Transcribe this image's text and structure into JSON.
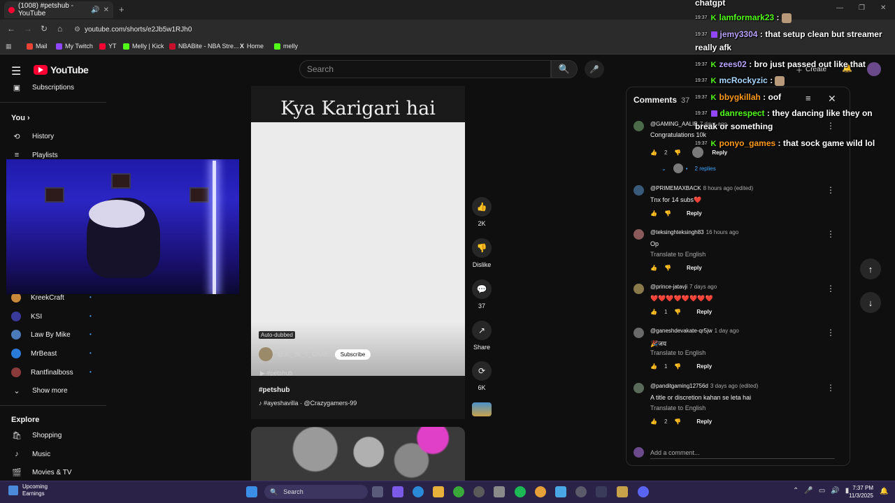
{
  "browser": {
    "tab_title": "(1008) #petshub - YouTube",
    "new_tab": "+",
    "url": "youtube.com/shorts/e2Jb5w1RJh0",
    "bookmarks": [
      {
        "label": "Mail",
        "color": "#e8e8e8"
      },
      {
        "label": "My Twitch",
        "color": "#9146ff"
      },
      {
        "label": "YT",
        "color": "#ff0033"
      },
      {
        "label": "Melly | Kick",
        "color": "#53fc18"
      },
      {
        "label": "NBABite - NBA Stre...",
        "color": "#c8102e"
      },
      {
        "label": "Home",
        "color": "#e8e8e8"
      },
      {
        "label": "melly",
        "color": "#53fc18"
      }
    ]
  },
  "youtube": {
    "logo_text": "YouTube",
    "search_placeholder": "Search",
    "create_label": "Create"
  },
  "sidebar": {
    "subscriptions": "Subscriptions",
    "you": "You",
    "you_chevron": "›",
    "history": "History",
    "playlists": "Playlists",
    "channels": [
      {
        "name": "KreekCraft",
        "color": "#c88a3a"
      },
      {
        "name": "KSI",
        "color": "#3a3a9a"
      },
      {
        "name": "Law By Mike",
        "color": "#4a7ab8"
      },
      {
        "name": "MrBeast",
        "color": "#2a7ad8"
      },
      {
        "name": "Rantfinalboss",
        "color": "#8a3a3a"
      }
    ],
    "show_more": "Show more",
    "explore": "Explore",
    "explore_items": [
      "Shopping",
      "Music",
      "Movies & TV"
    ]
  },
  "short": {
    "title_overlay": "Kya Karigari hai",
    "auto_dubbed": "Auto-dubbed",
    "channel": "@30_36_Y_GAME",
    "subscribe": "Subscribe",
    "tagline": "#petshub",
    "hashtag": "#petshub",
    "music": "#ayeshavilla · @Crazygamers-99",
    "actions": [
      {
        "icon": "like",
        "glyph": "👍",
        "label": "2K"
      },
      {
        "icon": "dislike",
        "glyph": "👎",
        "label": "Dislike"
      },
      {
        "icon": "comment",
        "glyph": "💬",
        "label": "37"
      },
      {
        "icon": "share",
        "glyph": "↗",
        "label": "Share"
      },
      {
        "icon": "remix",
        "glyph": "⟳",
        "label": "6K"
      }
    ]
  },
  "comments": {
    "title": "Comments",
    "count": "37",
    "add_placeholder": "Add a comment...",
    "items": [
      {
        "author": "@GAMING_AALIB",
        "time": "7 days ago",
        "text": "Congratulations 10k",
        "translate": "",
        "likes": "2",
        "reply": "Reply",
        "replies": "2 replies",
        "av": "#4a6a4a"
      },
      {
        "author": "@PRIMEMAXBACK",
        "time": "8 hours ago (edited)",
        "text": "Tnx for 14 subs❤️",
        "translate": "",
        "likes": "",
        "reply": "Reply",
        "replies": "",
        "av": "#3a5a7a"
      },
      {
        "author": "@teksinghteksingh83",
        "time": "16 hours ago",
        "text": "Op",
        "translate": "Translate to English",
        "likes": "",
        "reply": "Reply",
        "replies": "",
        "av": "#8a5a5a"
      },
      {
        "author": "@prince-jatavji",
        "time": "7 days ago",
        "text": "❤️❤️❤️❤️❤️❤️❤️❤️",
        "translate": "",
        "likes": "1",
        "reply": "Reply",
        "replies": "",
        "av": "#8a7a4a"
      },
      {
        "author": "@ganeshdevakate-qr5jw",
        "time": "1 day ago",
        "text": "🎉जय",
        "translate": "Translate to English",
        "likes": "1",
        "reply": "Reply",
        "replies": "",
        "av": "#6a6a6a"
      },
      {
        "author": "@panditgaming12756d",
        "time": "3 days ago (edited)",
        "text": "A title or discretion kahan se leta hai",
        "translate": "Translate to English",
        "likes": "2",
        "reply": "Reply",
        "replies": "",
        "av": "#5a6a5a"
      }
    ]
  },
  "chat": [
    {
      "time": "",
      "platform": "",
      "user": "chatgpt",
      "user_color": "#ffffff",
      "msg": ""
    },
    {
      "time": "19:37",
      "platform": "kick",
      "user": "lamformark23",
      "user_color": "#53fc18",
      "msg": ":"
    },
    {
      "time": "19:37",
      "platform": "twitch",
      "user": "jemy3304",
      "user_color": "#b9a3ff",
      "msg": ": that setup clean but streamer"
    },
    {
      "time": "",
      "platform": "",
      "user": "",
      "user_color": "#ffffff",
      "msg": "really afk"
    },
    {
      "time": "19:37",
      "platform": "kick",
      "user": "zees02",
      "user_color": "#b9a3ff",
      "msg": ": bro just passed out like that"
    },
    {
      "time": "19:37",
      "platform": "kick",
      "user": "mcRockyzic",
      "user_color": "#a8d8ff",
      "msg": ":"
    },
    {
      "time": "19:37",
      "platform": "kick",
      "user": "bbygkillah",
      "user_color": "#ff9a1a",
      "msg": ": oof"
    },
    {
      "time": "19:37",
      "platform": "twitch",
      "user": "danrespect",
      "user_color": "#53fc18",
      "msg": ": they dancing like they on"
    },
    {
      "time": "",
      "platform": "",
      "user": "",
      "user_color": "#ffffff",
      "msg": "break or something"
    },
    {
      "time": "19:37",
      "platform": "kick",
      "user": "ponyo_games",
      "user_color": "#ff9a1a",
      "msg": ": that sock game wild lol"
    }
  ],
  "taskbar": {
    "weather_title": "Upcoming",
    "weather_sub": "Earnings",
    "search": "Search",
    "time": "7:37 PM",
    "date": "11/3/2025"
  }
}
